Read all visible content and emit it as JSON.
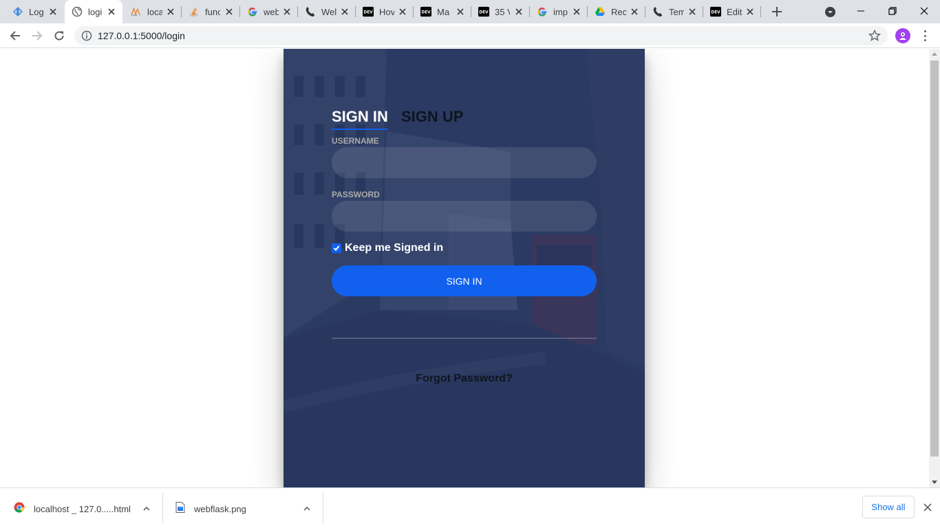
{
  "browser": {
    "tabs": [
      {
        "title": "Log",
        "icon": "code-editor-icon",
        "active": false
      },
      {
        "title": "logi",
        "icon": "globe-icon",
        "active": true
      },
      {
        "title": "loca",
        "icon": "phpmyadmin-icon",
        "active": false
      },
      {
        "title": "func",
        "icon": "stackoverflow-icon",
        "active": false
      },
      {
        "title": "web",
        "icon": "google-icon",
        "active": false
      },
      {
        "title": "Wel",
        "icon": "web-phone-icon",
        "active": false
      },
      {
        "title": "Hov",
        "icon": "dev-icon",
        "active": false
      },
      {
        "title": "Ma",
        "icon": "dev-icon",
        "active": false
      },
      {
        "title": "35 V",
        "icon": "dev-icon",
        "active": false
      },
      {
        "title": "imp",
        "icon": "google-icon",
        "active": false
      },
      {
        "title": "Rec",
        "icon": "google-drive-icon",
        "active": false
      },
      {
        "title": "Tem",
        "icon": "web-phone-icon",
        "active": false
      },
      {
        "title": "Edit",
        "icon": "dev-icon",
        "active": false
      }
    ],
    "dev_badge": "DEV",
    "url": "127.0.0.1:5000/login"
  },
  "login": {
    "tab_signin": "SIGN IN",
    "tab_signup": "SIGN UP",
    "username_label": "USERNAME",
    "username_value": "",
    "password_label": "PASSWORD",
    "password_value": "",
    "keep_signed_in_label": "Keep me Signed in",
    "keep_signed_in_checked": true,
    "submit_label": "SIGN IN",
    "forgot_label": "Forgot Password?"
  },
  "downloads": {
    "items": [
      {
        "filename": "localhost _ 127.0.....html",
        "icon": "chrome-icon"
      },
      {
        "filename": "webflask.png",
        "icon": "image-file-icon"
      }
    ],
    "show_all_label": "Show all"
  },
  "colors": {
    "accent": "#1161ee",
    "card_overlay": "#283965",
    "tabstrip": "#dee1e6"
  }
}
